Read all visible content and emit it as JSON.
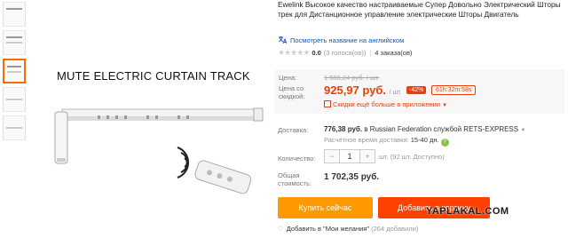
{
  "gallery": {
    "thumbnails": [
      "thumb-1",
      "thumb-2",
      "thumb-3",
      "thumb-4",
      "thumb-5"
    ],
    "active_index": 2,
    "image_caption": "MUTE ELECTRIC CURTAIN TRACK"
  },
  "product": {
    "title": "Ewelink Высокое качество настраиваемые Супер Довольно Электрический Шторы трек для Дистанционное управление электрические Шторы Двигатель",
    "translate_link": "Посмотреть название на английском",
    "rating": {
      "score": "0.0",
      "votes": "(3 голоса(ов))",
      "orders": "4 заказа(ов)"
    }
  },
  "price": {
    "price_label": "Цена:",
    "old_price": "1 586,24 руб. / шт.",
    "discount_label": "Цена со скидкой:",
    "new_price": "925,97 руб.",
    "unit": "/ шт.",
    "discount_badge": "-42%",
    "timer": "61h:32m:58s",
    "app_discount": "Скидки ещё больше в приложении"
  },
  "shipping": {
    "label": "Доставка:",
    "cost": "776,38 руб.",
    "cost_rest": " в Russian Federation службой RETS-EXPRESS",
    "time_label": "Расчётное время доставки: ",
    "time_days": "15-40 дн."
  },
  "quantity": {
    "label": "Количество:",
    "minus": "−",
    "value": "1",
    "plus": "+",
    "info": "шт. (92 шт. Доступно)"
  },
  "total": {
    "label": "Общая стоимость:",
    "value": "1 702,35 руб."
  },
  "actions": {
    "buy_now": "Купить сейчас",
    "add_to_cart": "Добавить в корзину"
  },
  "wishlist": {
    "text": "Добавить в \"Мои желания\"",
    "count": "(264 добавили)"
  },
  "watermark": "YAPLAKAL.COM",
  "colors": {
    "accent_orange": "#ff9900",
    "accent_red": "#ff4000",
    "price_red": "#e8400c",
    "link_blue": "#0a55c7"
  }
}
